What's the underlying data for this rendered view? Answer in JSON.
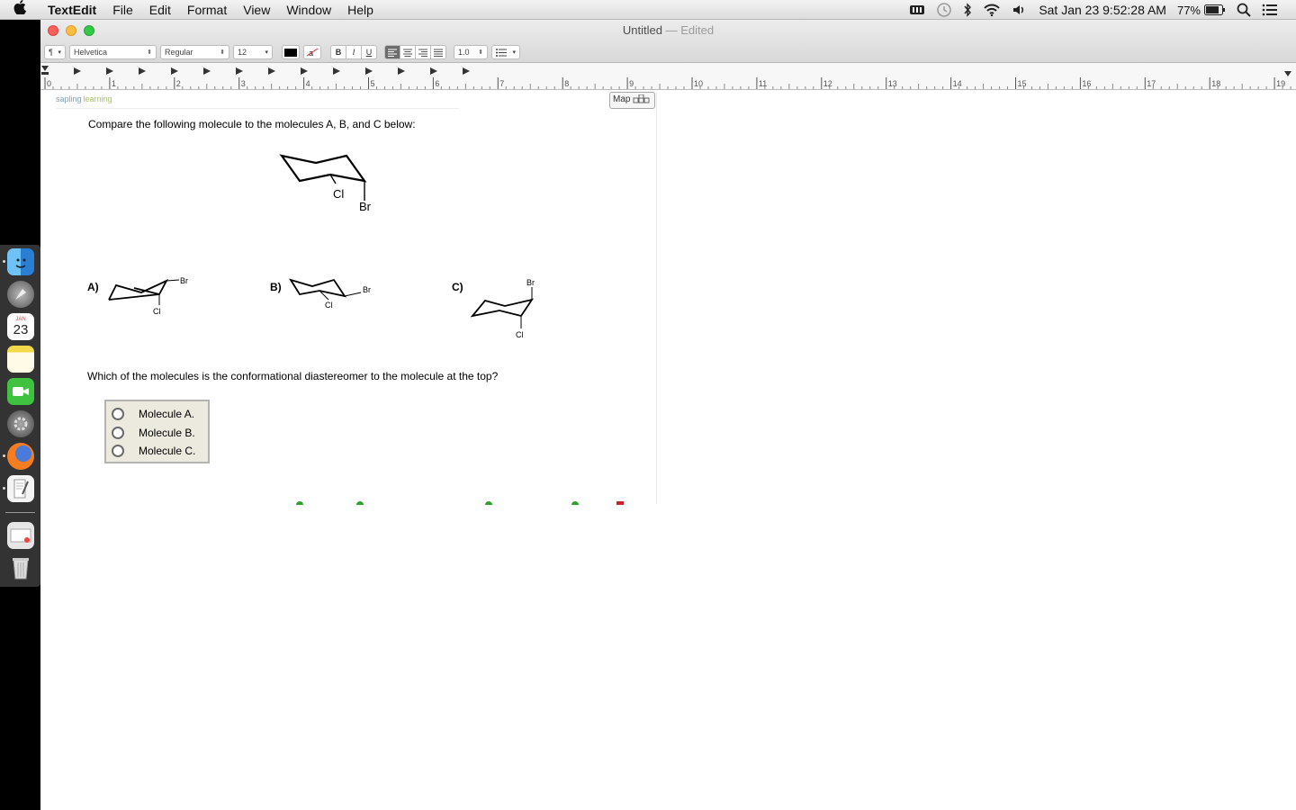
{
  "menubar": {
    "app_name": "TextEdit",
    "menus": [
      "File",
      "Edit",
      "Format",
      "View",
      "Window",
      "Help"
    ],
    "clock": "Sat Jan 23  9:52:28 AM",
    "battery": "77%"
  },
  "window": {
    "title": "Untitled",
    "title_sep": "—",
    "title_state": "Edited"
  },
  "toolbar": {
    "paragraph_style": "¶",
    "font_family": "Helvetica",
    "font_style": "Regular",
    "font_size": "12",
    "bold": "B",
    "italic": "I",
    "underline": "U",
    "line_spacing": "1.0"
  },
  "ruler": {
    "numbers": [
      "0",
      "1",
      "2",
      "3",
      "4",
      "5",
      "6",
      "7",
      "8",
      "9",
      "10",
      "11",
      "12",
      "13",
      "14",
      "15",
      "16",
      "17",
      "18",
      "19"
    ]
  },
  "document": {
    "logo_part1": "sapling",
    "logo_part2": "learning",
    "map_button": "Map",
    "question_intro": "Compare the following molecule to the molecules A, B, and C below:",
    "molecule_labels": [
      "A)",
      "B)",
      "C)"
    ],
    "substituents": {
      "top_cl": "Cl",
      "top_br": "Br",
      "a_br": "Br",
      "a_cl": "Cl",
      "b_br": "Br",
      "b_cl": "Cl",
      "c_br": "Br",
      "c_cl": "Cl"
    },
    "question": "Which of the molecules is the conformational diastereomer to the molecule at the top?",
    "answers": [
      "Molecule A.",
      "Molecule B.",
      "Molecule C."
    ]
  },
  "dock": {
    "calendar_month": "JAN",
    "calendar_day": "23"
  },
  "colors": {
    "close": "#fc605b",
    "minimize": "#fdbc40",
    "zoom": "#34c84a",
    "answer_box": "#eceadf"
  }
}
